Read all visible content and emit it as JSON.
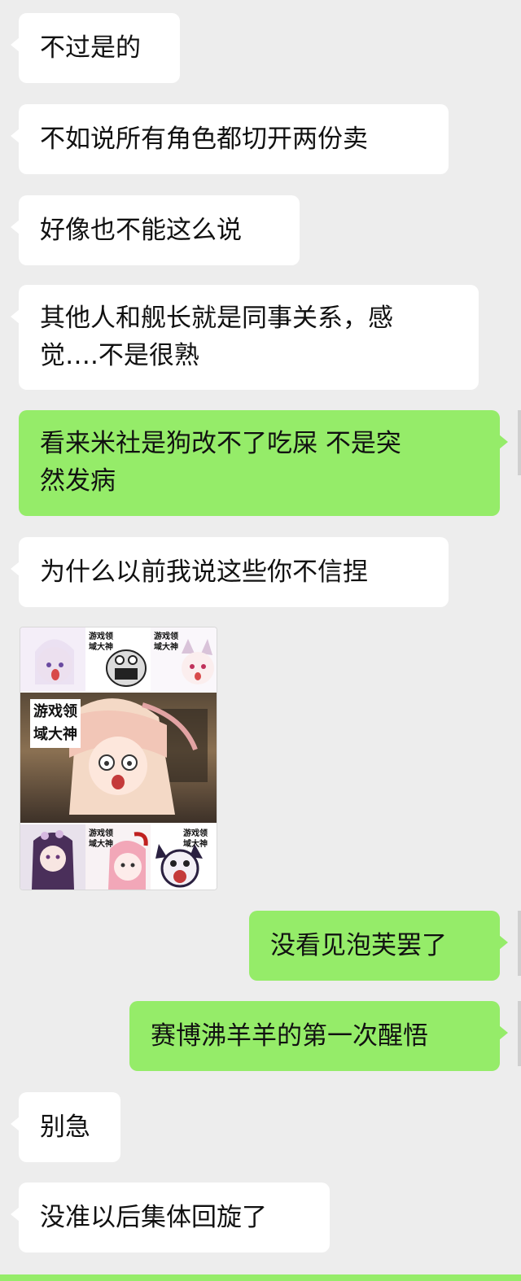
{
  "messages": [
    {
      "side": "left",
      "text": "不过是的"
    },
    {
      "side": "left",
      "text": "不如说所有角色都切开两份卖"
    },
    {
      "side": "left",
      "text": "好像也不能这么说"
    },
    {
      "side": "left",
      "lines": [
        "其他人和舰长就是同事关系，感",
        "觉….不是很熟"
      ]
    },
    {
      "side": "right",
      "lines": [
        "看来米社是狗改不了吃屎 不是突",
        "然发病"
      ]
    },
    {
      "side": "left",
      "text": "为什么以前我说这些你不信捏"
    },
    {
      "side": "right",
      "text": "没看见泡芙罢了"
    },
    {
      "side": "right",
      "text": "赛博沸羊羊的第一次醒悟"
    },
    {
      "side": "left",
      "text": "别急"
    },
    {
      "side": "left",
      "text": "没准以后集体回旋了"
    }
  ],
  "sticker": {
    "big_caption_1": "游戏领",
    "big_caption_2": "域大神",
    "small_caption_a": "游戏领",
    "small_caption_b": "域大神"
  },
  "colors": {
    "background": "#ededed",
    "left_bubble": "#ffffff",
    "right_bubble": "#95ec69",
    "text": "#111111"
  }
}
